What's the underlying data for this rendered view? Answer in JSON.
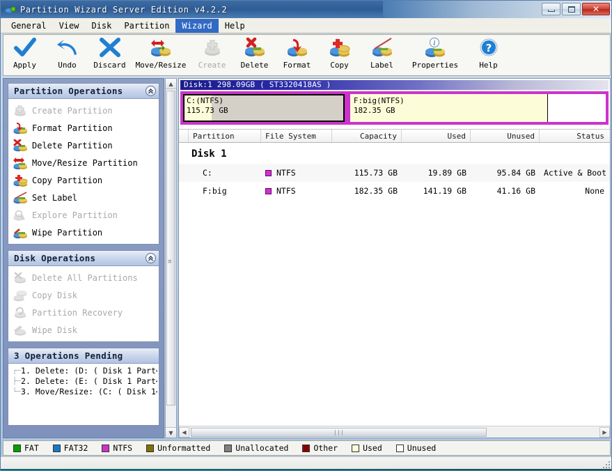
{
  "window": {
    "title": "Partition Wizard Server Edition v4.2.2",
    "minimize_label": "Minimize",
    "maximize_label": "Maximize",
    "close_label": "✕"
  },
  "menubar": {
    "items": [
      {
        "label": "General",
        "active": false
      },
      {
        "label": "View",
        "active": false
      },
      {
        "label": "Disk",
        "active": false
      },
      {
        "label": "Partition",
        "active": false
      },
      {
        "label": "Wizard",
        "active": true
      },
      {
        "label": "Help",
        "active": false
      }
    ]
  },
  "toolbar": {
    "buttons": [
      {
        "label": "Apply",
        "icon": "check-icon",
        "disabled": false
      },
      {
        "label": "Undo",
        "icon": "undo-arrow-icon",
        "disabled": false
      },
      {
        "label": "Discard",
        "icon": "cross-icon",
        "disabled": false
      },
      {
        "label": "Move/Resize",
        "icon": "move-resize-disk-icon",
        "disabled": false
      },
      {
        "label": "Create",
        "icon": "create-disk-icon",
        "disabled": true
      },
      {
        "label": "Delete",
        "icon": "delete-disk-icon",
        "disabled": false
      },
      {
        "label": "Format",
        "icon": "format-disk-icon",
        "disabled": false
      },
      {
        "label": "Copy",
        "icon": "copy-disk-icon",
        "disabled": false
      },
      {
        "label": "Label",
        "icon": "label-disk-icon",
        "disabled": false
      },
      {
        "label": "Properties",
        "icon": "properties-disk-icon",
        "disabled": false
      },
      {
        "label": "Help",
        "icon": "help-question-icon",
        "disabled": false
      }
    ]
  },
  "sidebar": {
    "partition_operations": {
      "title": "Partition Operations",
      "collapse_glyph": "«",
      "items": [
        {
          "label": "Create Partition",
          "icon": "create-partition-icon",
          "disabled": true
        },
        {
          "label": "Format Partition",
          "icon": "format-partition-icon",
          "disabled": false
        },
        {
          "label": "Delete Partition",
          "icon": "delete-partition-icon",
          "disabled": false
        },
        {
          "label": "Move/Resize Partition",
          "icon": "move-resize-partition-icon",
          "disabled": false
        },
        {
          "label": "Copy Partition",
          "icon": "copy-partition-icon",
          "disabled": false
        },
        {
          "label": "Set Label",
          "icon": "set-label-icon",
          "disabled": false
        },
        {
          "label": "Explore Partition",
          "icon": "explore-partition-icon",
          "disabled": true
        },
        {
          "label": "Wipe Partition",
          "icon": "wipe-partition-icon",
          "disabled": false
        }
      ]
    },
    "disk_operations": {
      "title": "Disk Operations",
      "collapse_glyph": "«",
      "items": [
        {
          "label": "Delete All Partitions",
          "icon": "delete-all-partitions-icon",
          "disabled": true
        },
        {
          "label": "Copy Disk",
          "icon": "copy-disk-icon",
          "disabled": true
        },
        {
          "label": "Partition Recovery",
          "icon": "partition-recovery-icon",
          "disabled": true
        },
        {
          "label": "Wipe Disk",
          "icon": "wipe-disk-icon",
          "disabled": true
        }
      ]
    },
    "pending": {
      "title": "3 Operations Pending",
      "items": [
        "1. Delete: (D: ( Disk 1 Part⋯",
        "2. Delete: (E: ( Disk 1 Part⋯",
        "3. Move/Resize: (C: ( Disk 1⋯"
      ]
    }
  },
  "disk_map": {
    "header": "Disk:1 298.09GB   ( ST3320418AS )",
    "partitions": [
      {
        "name": "C:(NTFS)",
        "size": "115.73 GB",
        "selected": true,
        "width_pct": 39.0,
        "used_pct": 17.2,
        "used_color": "#fcfcd8",
        "body_color": "#d4d0c8",
        "border_color": "#cc33cc"
      },
      {
        "name": "F:big(NTFS)",
        "size": "182.35 GB",
        "selected": false,
        "width_pct": 61.0,
        "used_pct": 77.4,
        "used_color": "#fcfcd8",
        "body_color": "#ffffff",
        "border_color": "#cc33cc"
      }
    ]
  },
  "table": {
    "columns": [
      "Partition",
      "File System",
      "Capacity",
      "Used",
      "Unused",
      "Status"
    ],
    "disk_group_label": "Disk 1",
    "rows": [
      {
        "partition": "C:",
        "file_system": "NTFS",
        "fs_color": "#cc33cc",
        "capacity": "115.73 GB",
        "used": "19.89 GB",
        "unused": "95.84 GB",
        "status": "Active & Boot &"
      },
      {
        "partition": "F:big",
        "file_system": "NTFS",
        "fs_color": "#cc33cc",
        "capacity": "182.35 GB",
        "used": "141.19 GB",
        "unused": "41.16 GB",
        "status": "None"
      }
    ]
  },
  "legend": {
    "items": [
      {
        "label": "FAT",
        "color": "#00a000"
      },
      {
        "label": "FAT32",
        "color": "#1878c8"
      },
      {
        "label": "NTFS",
        "color": "#cc33cc"
      },
      {
        "label": "Unformatted",
        "color": "#807000"
      },
      {
        "label": "Unallocated",
        "color": "#808080"
      },
      {
        "label": "Other",
        "color": "#8b0000"
      },
      {
        "label": "Used",
        "color": "#fcfcd8"
      },
      {
        "label": "Unused",
        "color": "#ffffff"
      }
    ]
  },
  "scrollbars": {
    "up_glyph": "▲",
    "down_glyph": "▼",
    "left_glyph": "◀",
    "right_glyph": "▶",
    "grip_glyph": "≡"
  },
  "statusbar": {
    "text": ""
  }
}
